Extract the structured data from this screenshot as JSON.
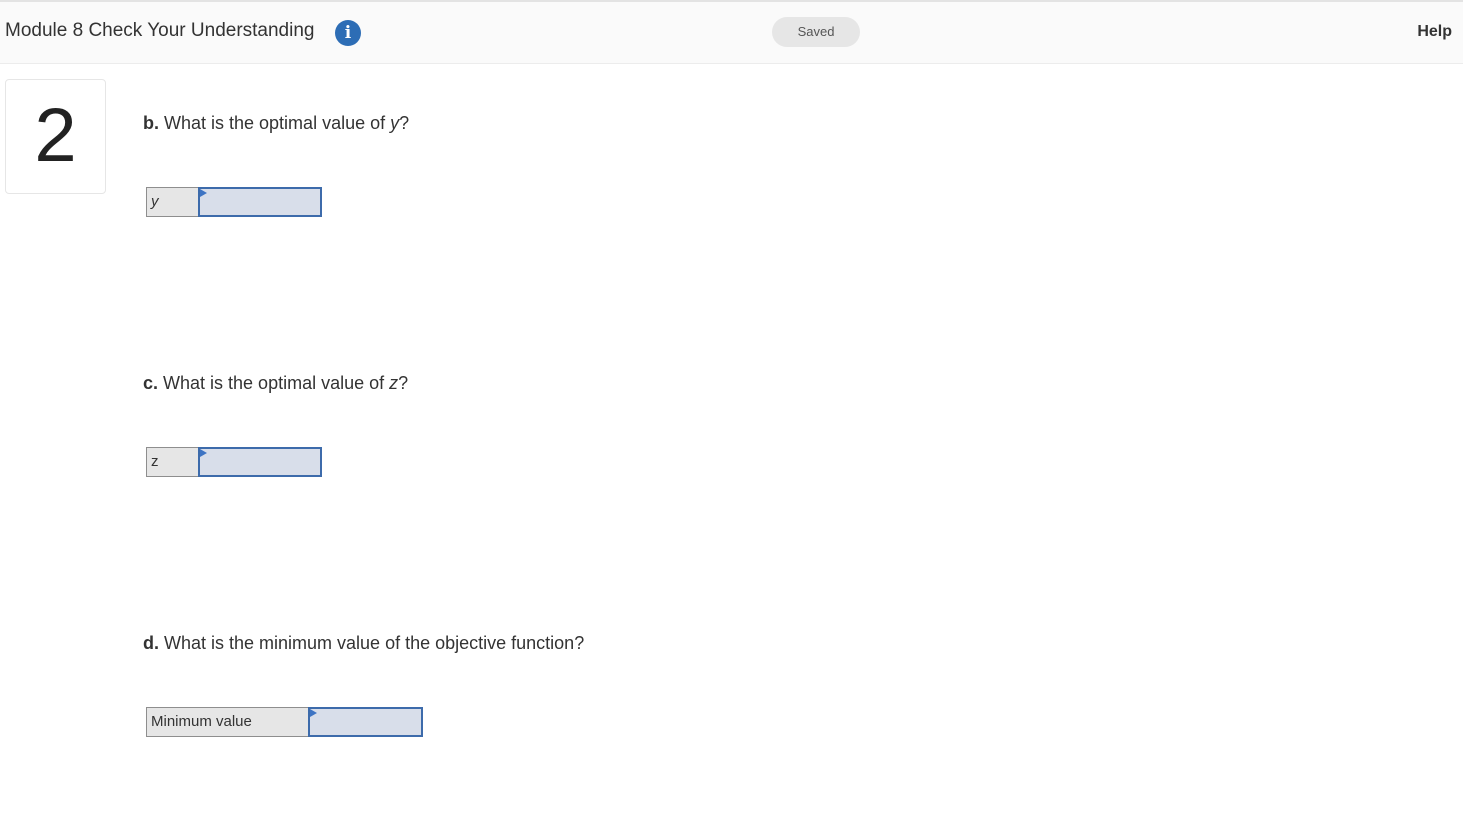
{
  "header": {
    "title": "Module 8 Check Your Understanding",
    "info_icon": "info-icon",
    "status": "Saved",
    "help_label": "Help"
  },
  "question_number": "2",
  "parts": [
    {
      "letter": "b.",
      "text_before": "What is the optimal value of ",
      "variable": "y",
      "text_after": "?",
      "input_label": "y",
      "input_value": ""
    },
    {
      "letter": "c.",
      "text_before": "What is the optimal value of ",
      "variable": "z",
      "text_after": "?",
      "input_label": "z",
      "input_value": ""
    },
    {
      "letter": "d.",
      "text_before": "What is the minimum value of the objective function?",
      "variable": "",
      "text_after": "",
      "input_label": "Minimum value",
      "input_value": ""
    }
  ],
  "colors": {
    "accent": "#2d6db5",
    "input_border": "#3d6bab",
    "input_fill": "#d8deea"
  }
}
